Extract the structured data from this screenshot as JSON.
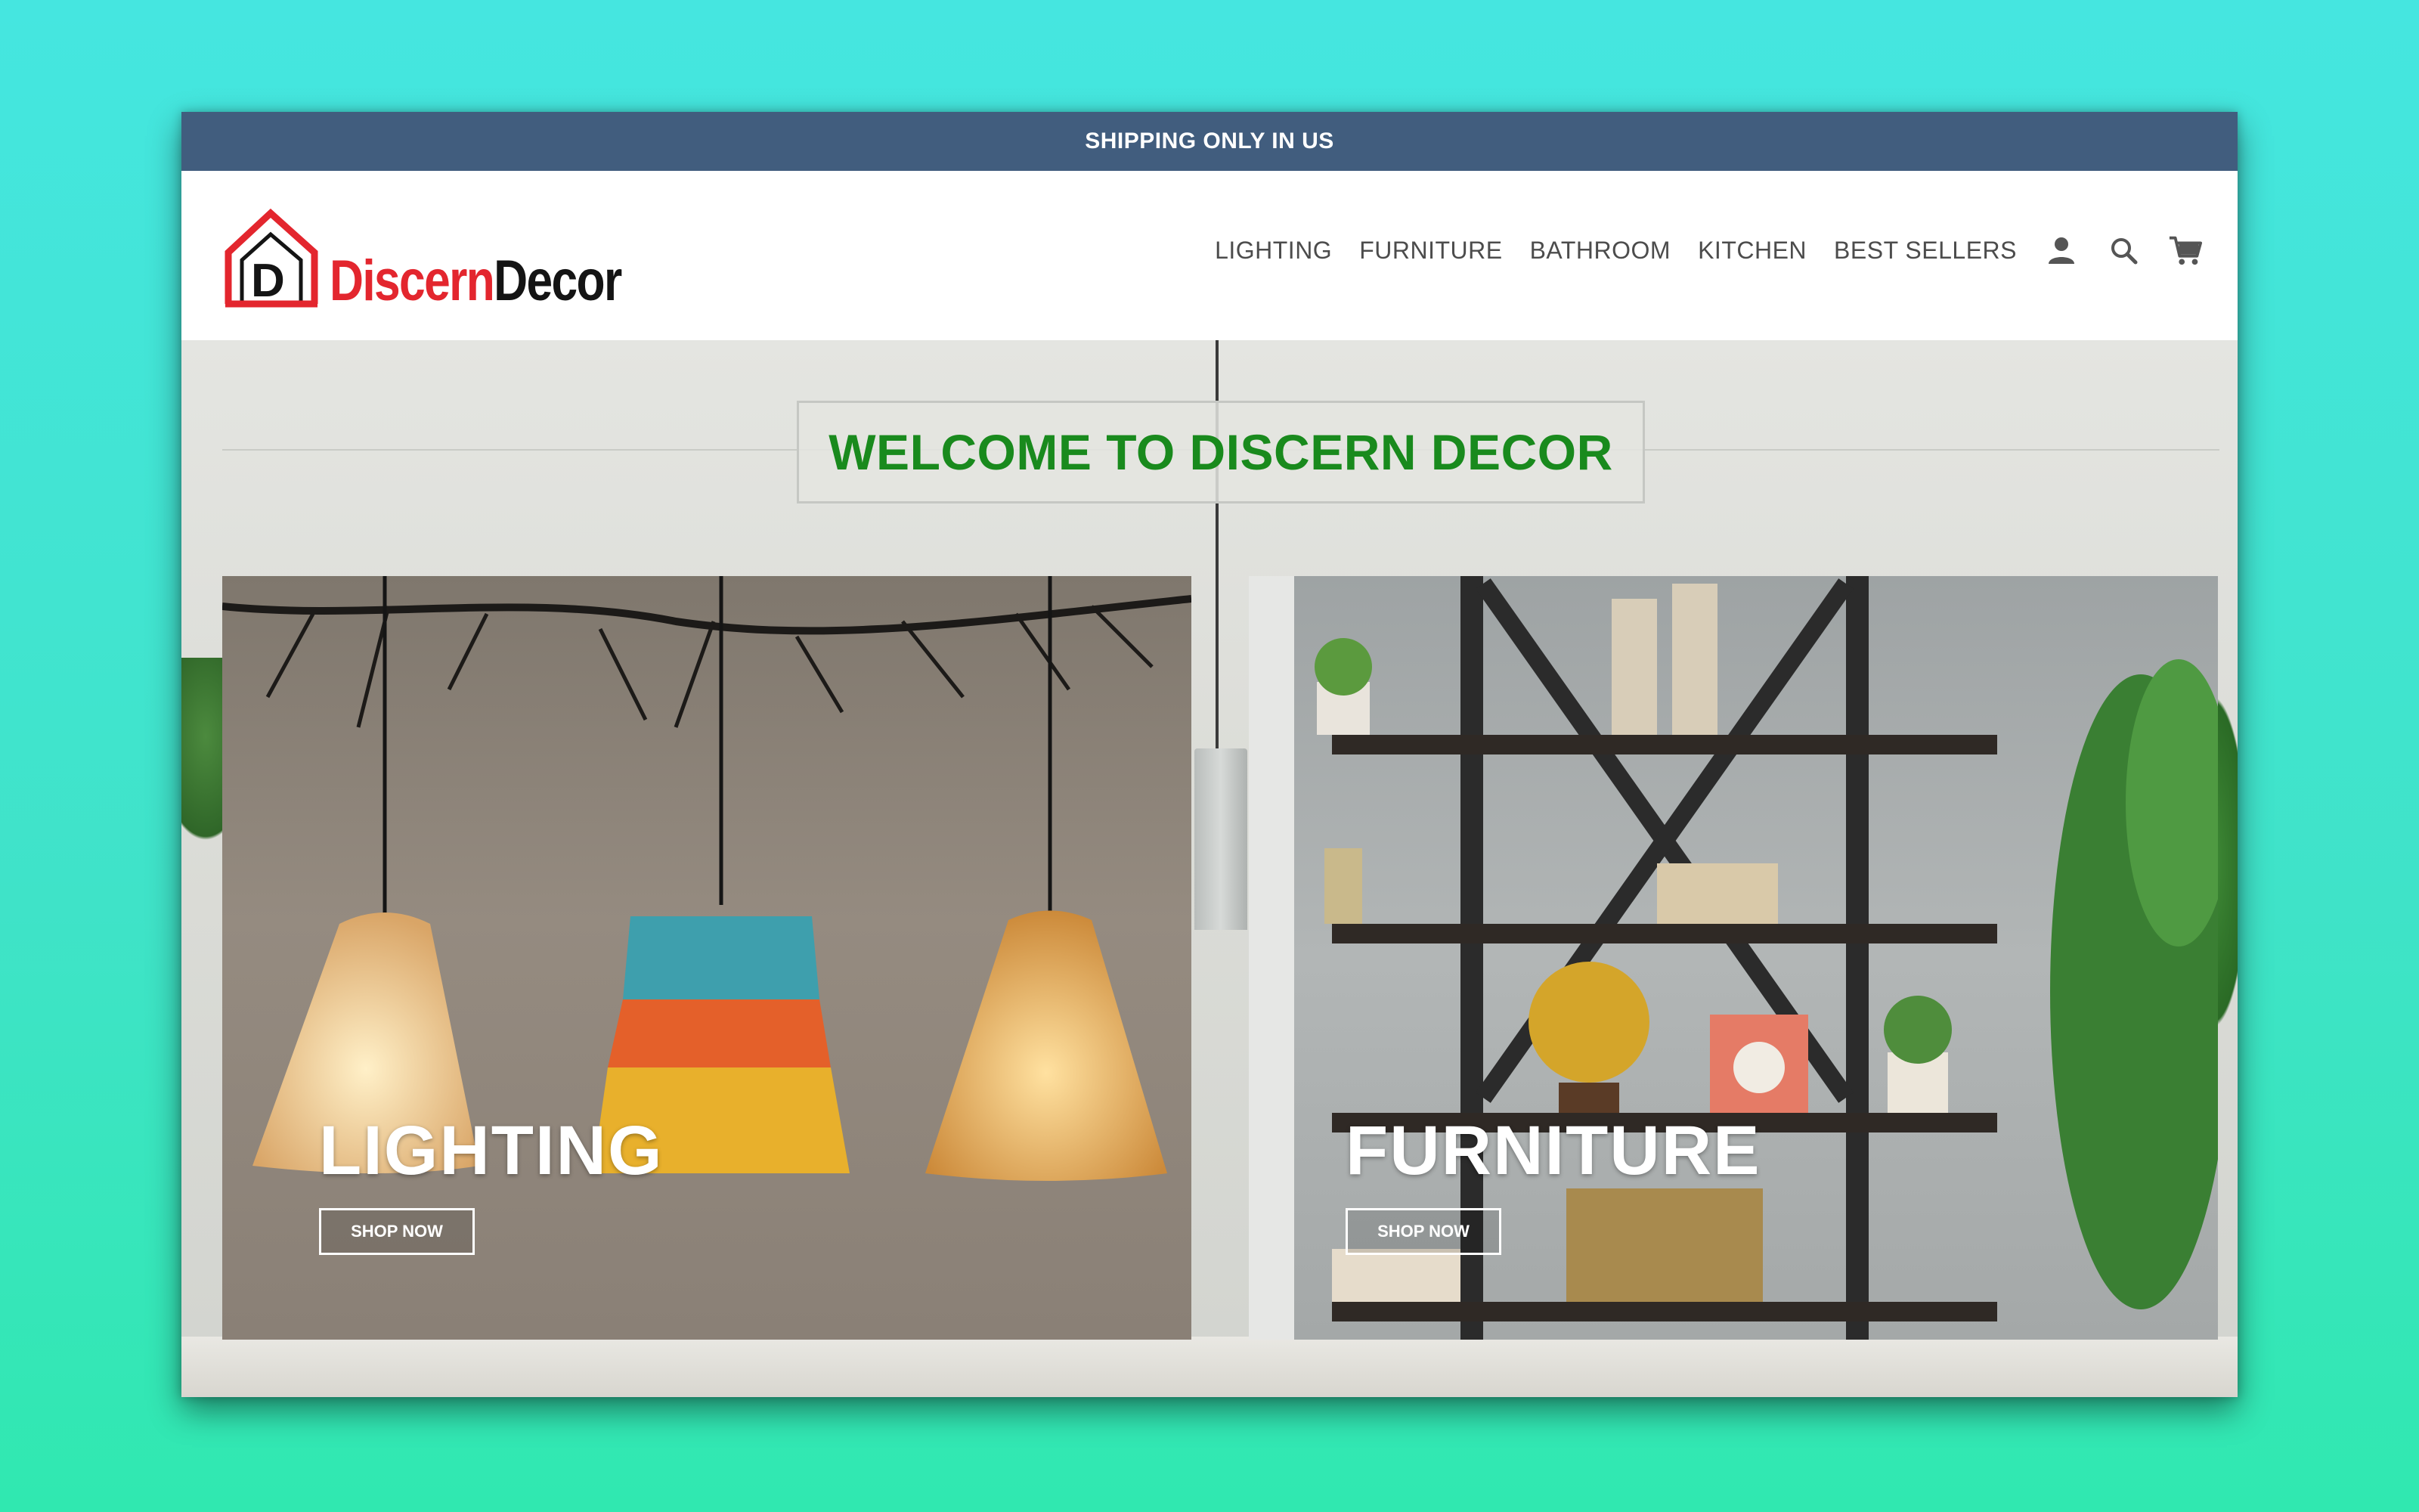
{
  "announcement": "SHIPPING ONLY IN US",
  "logo": {
    "part1": "Discern",
    "part2": "Decor",
    "mark_letter": "D"
  },
  "nav": {
    "items": [
      "LIGHTING",
      "FURNITURE",
      "BATHROOM",
      "KITCHEN",
      "BEST SELLERS"
    ],
    "icons": [
      "account-icon",
      "search-icon",
      "cart-icon"
    ]
  },
  "hero": {
    "welcome_title": "WELCOME TO DISCERN DECOR"
  },
  "categories": [
    {
      "title": "LIGHTING",
      "button": "SHOP NOW"
    },
    {
      "title": "FURNITURE",
      "button": "SHOP NOW"
    }
  ],
  "colors": {
    "announcement_bg": "#415d7e",
    "welcome_green": "#198a1d",
    "logo_red": "#e3262e",
    "page_bg": "#40e6d4"
  }
}
